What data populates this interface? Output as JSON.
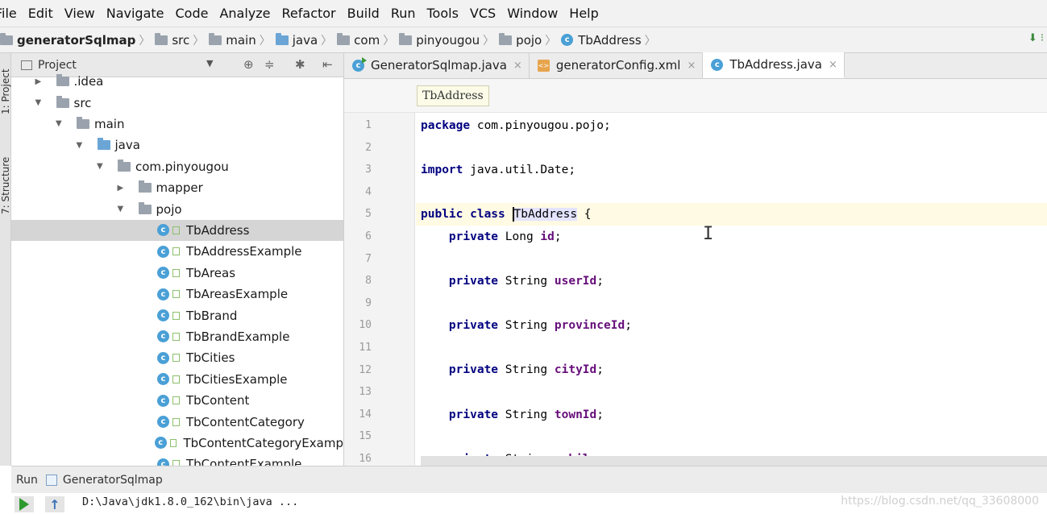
{
  "menu": [
    "File",
    "Edit",
    "View",
    "Navigate",
    "Code",
    "Analyze",
    "Refactor",
    "Build",
    "Run",
    "Tools",
    "VCS",
    "Window",
    "Help"
  ],
  "nav": {
    "project": "generatorSqlmap",
    "crumbs": [
      "src",
      "main",
      "java",
      "com",
      "pinyougou",
      "pojo",
      "TbAddress"
    ]
  },
  "sidebar": {
    "project_tab": "1: Project",
    "structure_tab": "7: Structure"
  },
  "project_panel": {
    "title": "Project",
    "tree": [
      {
        "label": ".idea",
        "depth": 1,
        "kind": "folder",
        "arrow": "▶"
      },
      {
        "label": "src",
        "depth": 1,
        "kind": "folder",
        "arrow": "▼"
      },
      {
        "label": "main",
        "depth": 2,
        "kind": "folder",
        "arrow": "▼"
      },
      {
        "label": "java",
        "depth": 3,
        "kind": "folder-blue",
        "arrow": "▼"
      },
      {
        "label": "com.pinyougou",
        "depth": 4,
        "kind": "folder",
        "arrow": "▼"
      },
      {
        "label": "mapper",
        "depth": 5,
        "kind": "folder",
        "arrow": "▶"
      },
      {
        "label": "pojo",
        "depth": 5,
        "kind": "folder",
        "arrow": "▼"
      },
      {
        "label": "TbAddress",
        "depth": 6,
        "kind": "class",
        "selected": true
      },
      {
        "label": "TbAddressExample",
        "depth": 6,
        "kind": "class"
      },
      {
        "label": "TbAreas",
        "depth": 6,
        "kind": "class"
      },
      {
        "label": "TbAreasExample",
        "depth": 6,
        "kind": "class"
      },
      {
        "label": "TbBrand",
        "depth": 6,
        "kind": "class"
      },
      {
        "label": "TbBrandExample",
        "depth": 6,
        "kind": "class"
      },
      {
        "label": "TbCities",
        "depth": 6,
        "kind": "class"
      },
      {
        "label": "TbCitiesExample",
        "depth": 6,
        "kind": "class"
      },
      {
        "label": "TbContent",
        "depth": 6,
        "kind": "class"
      },
      {
        "label": "TbContentCategory",
        "depth": 6,
        "kind": "class"
      },
      {
        "label": "TbContentCategoryExamp",
        "depth": 6,
        "kind": "class"
      },
      {
        "label": "TbContentExample",
        "depth": 6,
        "kind": "class"
      }
    ]
  },
  "editor": {
    "tabs": [
      {
        "label": "GeneratorSqlmap.java",
        "icon": "run-class-icon"
      },
      {
        "label": "generatorConfig.xml",
        "icon": "xml-icon"
      },
      {
        "label": "TbAddress.java",
        "icon": "class-icon",
        "active": true
      }
    ],
    "breadcrumb_chip": "TbAddress",
    "lines": [
      {
        "n": "1",
        "tokens": [
          {
            "t": "package",
            "c": "kw"
          },
          {
            "t": " com.pinyougou.pojo;",
            "c": ""
          }
        ]
      },
      {
        "n": "2",
        "tokens": []
      },
      {
        "n": "3",
        "tokens": [
          {
            "t": "import",
            "c": "kw"
          },
          {
            "t": " java.util.Date;",
            "c": ""
          }
        ]
      },
      {
        "n": "4",
        "tokens": []
      },
      {
        "n": "5",
        "current": true,
        "tokens": [
          {
            "t": "public class ",
            "c": "kw"
          },
          {
            "t": "",
            "c": "caret"
          },
          {
            "t": "TbAddress",
            "c": "hl"
          },
          {
            "t": " {",
            "c": ""
          }
        ]
      },
      {
        "n": "6",
        "tokens": [
          {
            "t": "    ",
            "c": ""
          },
          {
            "t": "private",
            "c": "kw"
          },
          {
            "t": " Long ",
            "c": ""
          },
          {
            "t": "id",
            "c": "fld"
          },
          {
            "t": ";",
            "c": ""
          }
        ]
      },
      {
        "n": "7",
        "tokens": []
      },
      {
        "n": "8",
        "tokens": [
          {
            "t": "    ",
            "c": ""
          },
          {
            "t": "private",
            "c": "kw"
          },
          {
            "t": " String ",
            "c": ""
          },
          {
            "t": "userId",
            "c": "fld"
          },
          {
            "t": ";",
            "c": ""
          }
        ]
      },
      {
        "n": "9",
        "tokens": []
      },
      {
        "n": "10",
        "tokens": [
          {
            "t": "    ",
            "c": ""
          },
          {
            "t": "private",
            "c": "kw"
          },
          {
            "t": " String ",
            "c": ""
          },
          {
            "t": "provinceId",
            "c": "fld"
          },
          {
            "t": ";",
            "c": ""
          }
        ]
      },
      {
        "n": "11",
        "tokens": []
      },
      {
        "n": "12",
        "tokens": [
          {
            "t": "    ",
            "c": ""
          },
          {
            "t": "private",
            "c": "kw"
          },
          {
            "t": " String ",
            "c": ""
          },
          {
            "t": "cityId",
            "c": "fld"
          },
          {
            "t": ";",
            "c": ""
          }
        ]
      },
      {
        "n": "13",
        "tokens": []
      },
      {
        "n": "14",
        "tokens": [
          {
            "t": "    ",
            "c": ""
          },
          {
            "t": "private",
            "c": "kw"
          },
          {
            "t": " String ",
            "c": ""
          },
          {
            "t": "townId",
            "c": "fld"
          },
          {
            "t": ";",
            "c": ""
          }
        ]
      },
      {
        "n": "15",
        "tokens": []
      },
      {
        "n": "16",
        "tokens": [
          {
            "t": "    ",
            "c": ""
          },
          {
            "t": "private",
            "c": "kw"
          },
          {
            "t": " String ",
            "c": ""
          },
          {
            "t": "mobile",
            "c": "fld"
          },
          {
            "t": ";",
            "c": ""
          }
        ]
      }
    ]
  },
  "run": {
    "label": "Run",
    "config_name": "GeneratorSqlmap",
    "console_text": "D:\\Java\\jdk1.8.0_162\\bin\\java ..."
  },
  "watermark": "https://blog.csdn.net/qq_33608000",
  "colors": {
    "keyword": "#000080",
    "field": "#660e7a",
    "class_icon": "#4aa0d6",
    "current_line": "#fffae3",
    "selection_row": "#d5d5d5"
  }
}
